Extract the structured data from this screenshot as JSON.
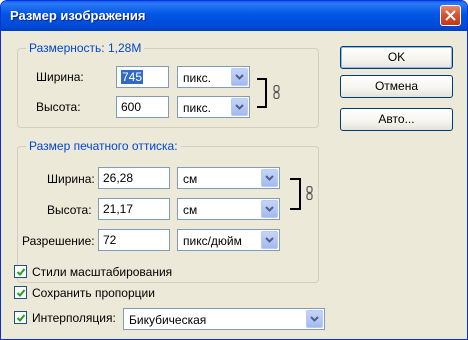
{
  "window": {
    "title": "Размер изображения"
  },
  "dimensions": {
    "legend": "Размерность:  1,28M",
    "width_label": "Ширина:",
    "width_value": "745",
    "width_unit": "пикс.",
    "height_label": "Высота:",
    "height_value": "600",
    "height_unit": "пикс."
  },
  "print_size": {
    "legend": "Размер печатного оттиска:",
    "width_label": "Ширина:",
    "width_value": "26,28",
    "width_unit": "см",
    "height_label": "Высота:",
    "height_value": "21,17",
    "height_unit": "см",
    "resolution_label": "Разрешение:",
    "resolution_value": "72",
    "resolution_unit": "пикс/дюйм"
  },
  "options": {
    "scale_styles": {
      "label": "Стили масштабирования",
      "checked": true
    },
    "constrain": {
      "label": "Сохранить пропорции",
      "checked": true
    },
    "resample": {
      "label": "Интерполяция:",
      "checked": true,
      "value": "Бикубическая"
    }
  },
  "buttons": {
    "ok": "OK",
    "cancel": "Отмена",
    "auto": "Авто..."
  }
}
